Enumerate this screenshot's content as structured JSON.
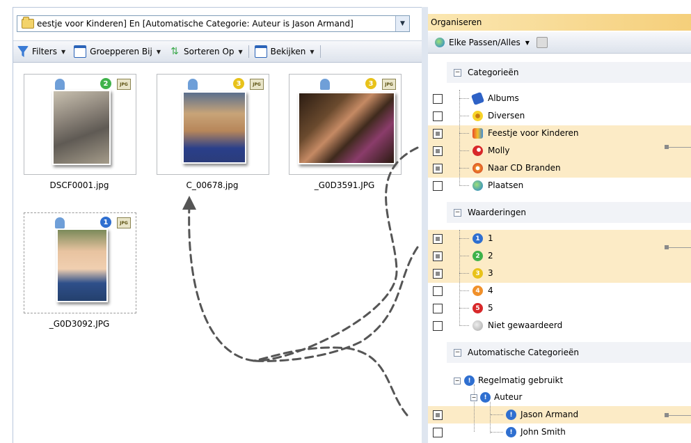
{
  "left": {
    "path_text": "eestje voor Kinderen] En [Automatische Categorie: Auteur is Jason Armand]",
    "toolbar": [
      {
        "label": "Filters",
        "icon": "filter-icon",
        "color": "#3a7bd5"
      },
      {
        "label": "Groepperen Bij",
        "icon": "group-icon",
        "color": "#2a63b8"
      },
      {
        "label": "Sorteren Op",
        "icon": "sort-icon",
        "color": "#3aa84a"
      },
      {
        "label": "Bekijken",
        "icon": "view-icon",
        "color": "#2a63b8"
      }
    ],
    "thumbnails": [
      {
        "filename": "DSCF0001.jpg",
        "rating": "2",
        "badge_color": "#3fb24a",
        "type": "JPG"
      },
      {
        "filename": "C_00678.jpg",
        "rating": "3",
        "badge_color": "#e8c21a",
        "type": "JPG"
      },
      {
        "filename": "_G0D3591.JPG",
        "rating": "3",
        "badge_color": "#e8c21a",
        "type": "JPG"
      },
      {
        "filename": "_G0D3092.JPG",
        "rating": "1",
        "badge_color": "#2f6fd0",
        "type": "JPG"
      }
    ]
  },
  "right": {
    "title": "Organiseren",
    "filter_label": "Elke Passen/Alles",
    "sections": {
      "categories": "Categorieën",
      "ratings": "Waarderingen",
      "auto": "Automatische Categorieën"
    },
    "categories": [
      {
        "label": "Albums",
        "icon": "albums-icon",
        "state": "unchecked"
      },
      {
        "label": "Diversen",
        "icon": "flower-icon",
        "state": "unchecked"
      },
      {
        "label": "Feestje voor Kinderen",
        "icon": "party-icon",
        "state": "mixed"
      },
      {
        "label": "Molly",
        "icon": "molly-icon",
        "state": "mixed"
      },
      {
        "label": "Naar CD Branden",
        "icon": "cd-burn-icon",
        "state": "mixed"
      },
      {
        "label": "Plaatsen",
        "icon": "globe-icon",
        "state": "unchecked"
      }
    ],
    "ratings": [
      {
        "label": "1",
        "badge": "1",
        "color": "#2f6fd0",
        "state": "mixed"
      },
      {
        "label": "2",
        "badge": "2",
        "color": "#3fb24a",
        "state": "mixed"
      },
      {
        "label": "3",
        "badge": "3",
        "color": "#e8c21a",
        "state": "mixed"
      },
      {
        "label": "4",
        "badge": "4",
        "color": "#f0902a",
        "state": "unchecked"
      },
      {
        "label": "5",
        "badge": "5",
        "color": "#d8282a",
        "state": "unchecked"
      },
      {
        "label": "Niet gewaardeerd",
        "badge": "",
        "color": "#b8b8b8",
        "state": "unchecked"
      }
    ],
    "auto": [
      {
        "label": "Regelmatig gebruikt",
        "level": 0
      },
      {
        "label": "Auteur",
        "level": 1
      },
      {
        "label": "Jason Armand",
        "level": 2,
        "state": "mixed"
      },
      {
        "label": "John Smith",
        "level": 2,
        "state": "unchecked"
      }
    ]
  }
}
